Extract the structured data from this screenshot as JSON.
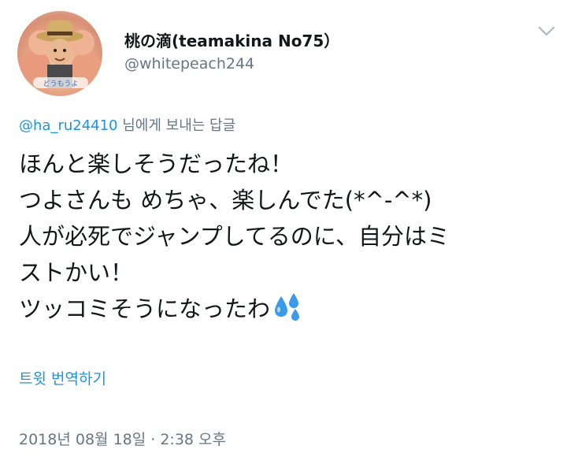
{
  "user": {
    "display_name": "桃の滴(teamakina No75）",
    "handle": "@whitepeach244"
  },
  "reply": {
    "mention": "@ha_ru24410",
    "suffix": " 님에게 보내는 답글"
  },
  "tweet": {
    "lines": [
      "ほんと楽しそうだったね！",
      "つよさんも めちゃ、楽しんでた(*^-^*)",
      "人が必死でジャンプしてるのに、自分はミ",
      "ストかい！",
      "ツッコミそうになったわ"
    ],
    "emoji": "sweat-droplets-icon"
  },
  "actions": {
    "translate_label": "트윗 번역하기"
  },
  "meta": {
    "timestamp": "2018년 08월 18일 · 2:38 오후"
  },
  "colors": {
    "link": "#1b95e0",
    "secondary_text": "#657786",
    "primary_text": "#14171a",
    "emoji_blue": "#3b9be8"
  }
}
